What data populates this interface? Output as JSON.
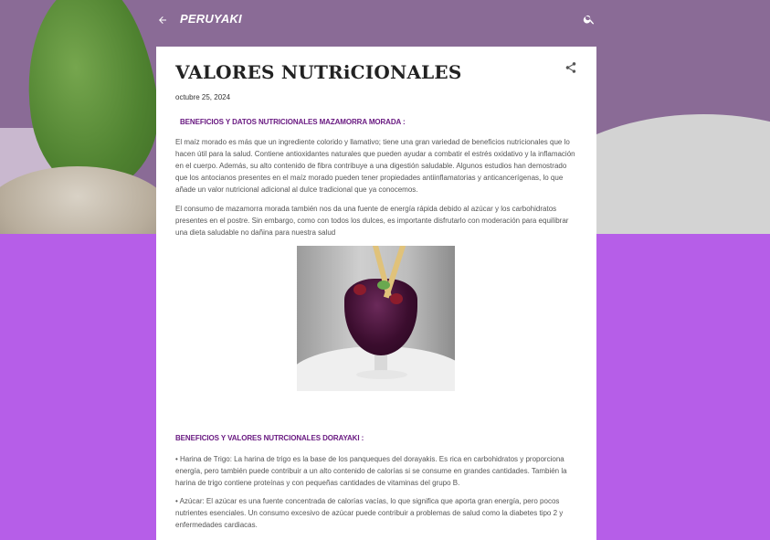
{
  "header": {
    "brand": "PERUYAKI",
    "back_icon": "arrow-left-icon",
    "search_icon": "search-icon"
  },
  "post": {
    "title": "VALORES NUTRiCIONALES",
    "date": "octubre 25, 2024",
    "share_icon": "share-icon",
    "section1_heading": "BENEFICIOS Y DATOS NUTRICIONALES MAZAMORRA MORADA :",
    "section1_p1": "El maíz morado es más que un ingrediente colorido y llamativo; tiene una gran variedad de beneficios nutricionales que lo hacen útil para la salud. Contiene antioxidantes naturales que pueden ayudar a combatir el estrés oxidativo y la inflamación en el cuerpo. Además, su alto contenido de fibra contribuye a una digestión saludable. Algunos estudios han demostrado que los antocianos presentes en el maíz morado pueden tener propiedades antiinflamatorias y anticancerígenas, lo que añade un valor nutricional adicional al dulce tradicional que ya conocemos.",
    "section1_p2": "El consumo de mazamorra morada también nos da una fuente de energía rápida debido al azúcar y los carbohidratos presentes en el postre. Sin embargo, como con todos los dulces, es importante disfrutarlo con moderación para equilibrar una dieta saludable no dañina para nuestra salud",
    "section2_heading": "BENEFICIOS Y VALORES NUTRCIONALES DORAYAKI :",
    "section2_p1": "• Harina de Trigo: La harina de trigo es la base de los panqueques del dorayakis. Es rica en carbohidratos y proporciona energía, pero también puede contribuir a un alto contenido de calorías si se consume en grandes cantidades. También la harina de trigo contiene proteínas y con pequeñas cantidades de vitaminas del grupo B.",
    "section2_p2": "• Azúcar: El azúcar es una fuente concentrada de calorías vacías, lo que significa que aporta gran energía, pero pocos nutrientes esenciales. Un consumo excesivo de azúcar puede contribuir a problemas de salud como la diabetes tipo 2 y enfermedades cardiacas."
  },
  "colors": {
    "background": "#b65ee8",
    "heading_accent": "#6a1b82",
    "brand_text": "#ffffff"
  }
}
